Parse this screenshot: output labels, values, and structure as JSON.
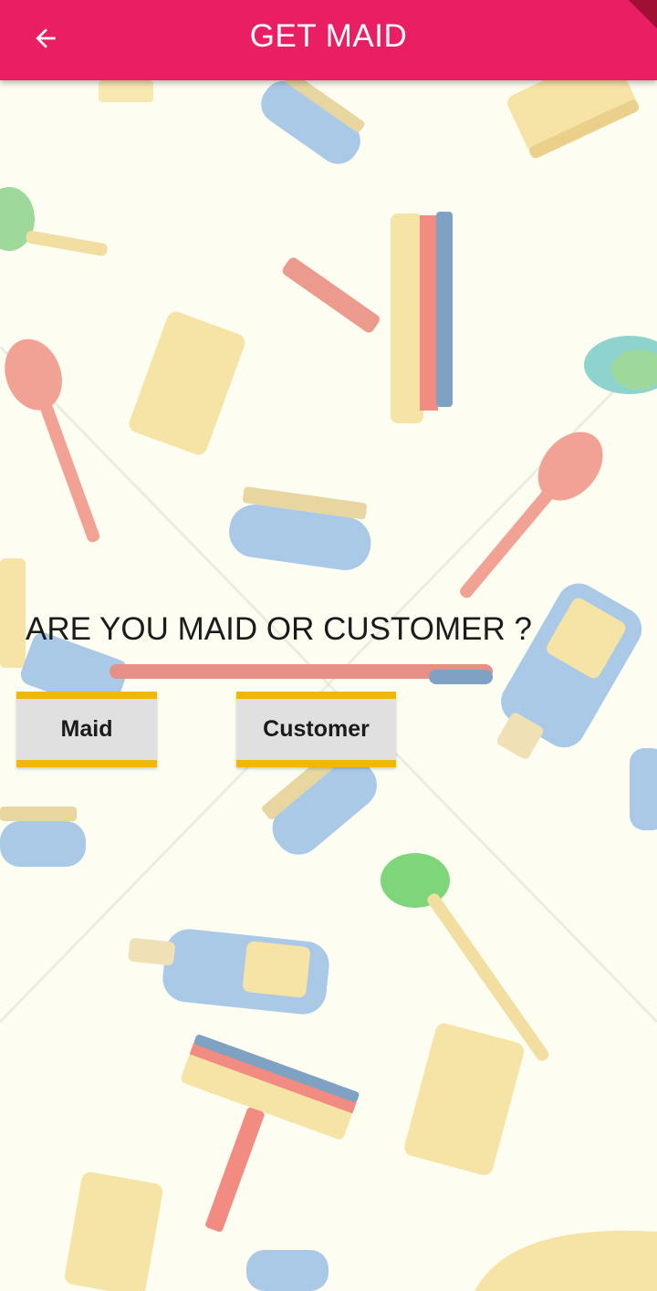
{
  "app_bar": {
    "title": "GET MAID",
    "back_icon": "arrow-back-icon",
    "background_color": "#e91e63"
  },
  "main": {
    "question": "ARE YOU MAID OR CUSTOMER ?",
    "buttons": {
      "maid_label": "Maid",
      "customer_label": "Customer"
    },
    "button_accent_color": "#f2b705",
    "button_color": "#e0e0e0"
  },
  "background": {
    "pattern": "cleaning-tools-pattern",
    "color": "#fdfdf2"
  }
}
